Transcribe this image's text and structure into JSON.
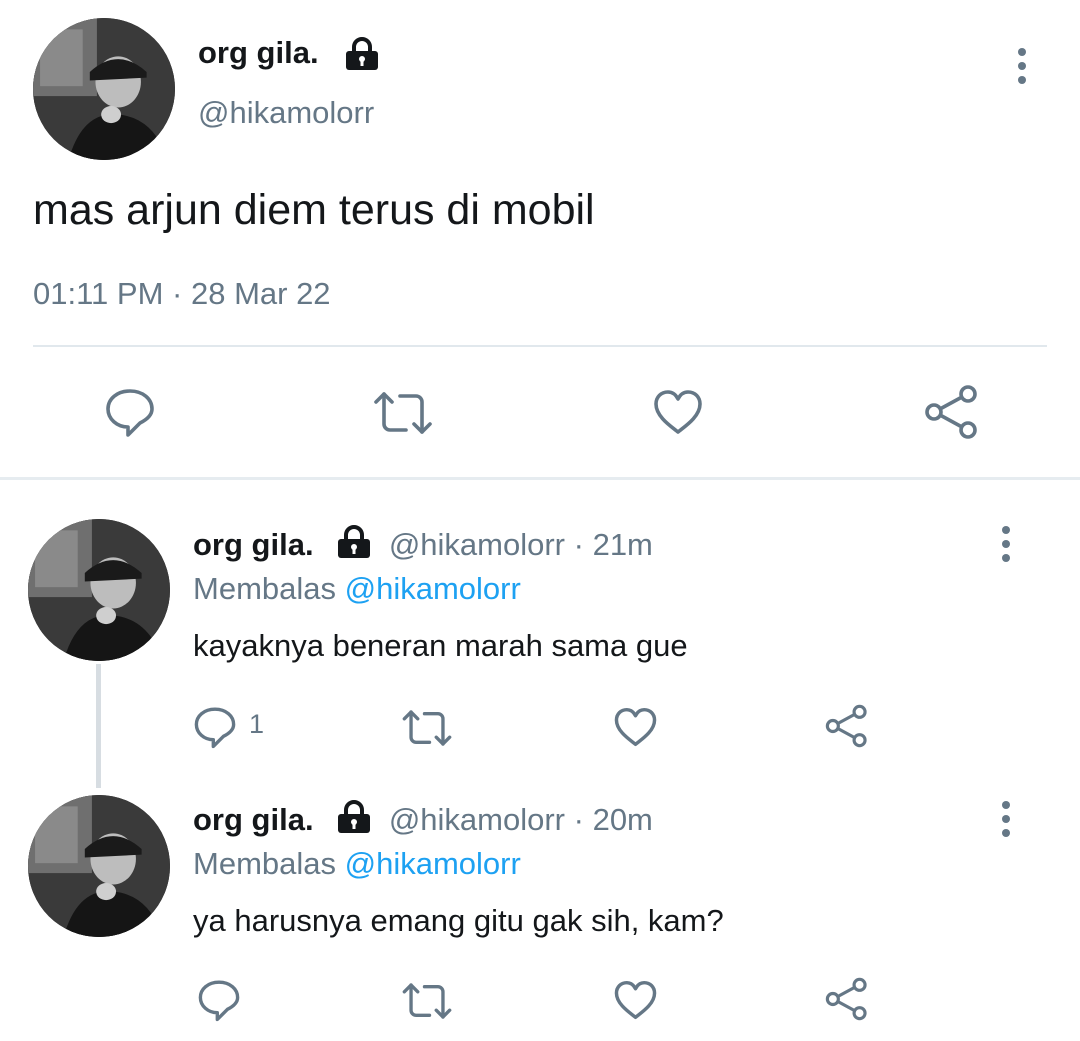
{
  "main_tweet": {
    "display_name": "org gila.",
    "handle": "@hikamolorr",
    "text": "mas arjun diem terus di mobil",
    "time": "01:11 PM",
    "separator": "·",
    "date": "28 Mar 22"
  },
  "replies": [
    {
      "display_name": "org gila.",
      "handle": "@hikamolorr",
      "time_ago": "· 21m",
      "replying_label": "Membalas",
      "replying_to": "@hikamolorr",
      "text": "kayaknya beneran marah sama gue",
      "reply_count": "1"
    },
    {
      "display_name": "org gila.",
      "handle": "@hikamolorr",
      "time_ago": "· 20m",
      "replying_label": "Membalas",
      "replying_to": "@hikamolorr",
      "text": "ya harusnya emang gitu gak sih, kam?",
      "reply_count": ""
    }
  ],
  "colors": {
    "accent": "#1da1f2",
    "icon": "#657786",
    "text": "#14171a",
    "divider": "#e1e8ed"
  }
}
